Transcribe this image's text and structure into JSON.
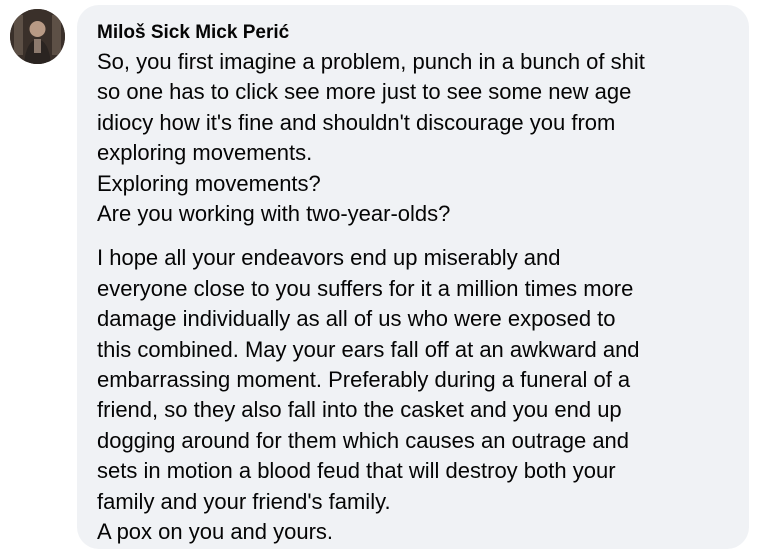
{
  "comment": {
    "author": "Miloš Sick Mick Perić",
    "paragraph1": [
      "So, you first imagine a problem, punch in a bunch of shit",
      "so one has to click see more just to see some new age",
      "idiocy how it's fine and shouldn't discourage you from",
      "exploring movements.",
      "Exploring movements?",
      "Are you working with two-year-olds?"
    ],
    "paragraph2": [
      "I hope all your endeavors end up miserably and",
      "everyone close to you suffers for it a million times more",
      "damage individually as all of us who were exposed to",
      "this combined. May your ears fall off at an awkward and",
      "embarrassing moment. Preferably during a funeral of a",
      "friend, so they also fall into the casket and you end up",
      "dogging around for them which causes an outrage and",
      "sets in motion a blood feud that will destroy both your",
      "family and your friend's family.",
      "A pox on you and yours."
    ]
  },
  "colors": {
    "bubble_background": "#f0f2f5",
    "text": "#050505"
  }
}
